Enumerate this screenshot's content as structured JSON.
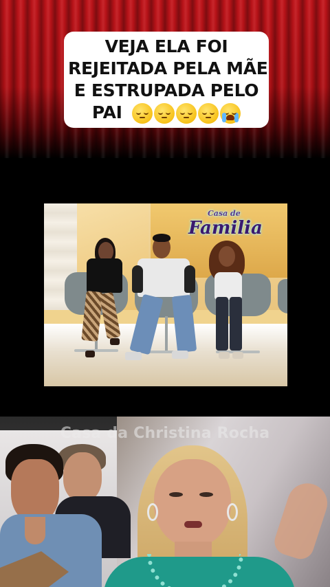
{
  "caption": {
    "line1": "VEJA ELA FOI",
    "line2": "REJEITADA PELA MÃE",
    "line3": "E ESTRUPADA PELO",
    "line4": "PAI",
    "emojis": [
      "pensive-face",
      "pensive-face",
      "pensive-face",
      "pensive-face",
      "loudly-crying-face"
    ]
  },
  "video": {
    "show_logo_small": "Casa",
    "show_logo_small2": "de",
    "show_logo_big": "Familia"
  },
  "bottom": {
    "watermark": "Casa da Christina Rocha"
  },
  "colors": {
    "curtain_red": "#c3141a",
    "dress_teal": "#1f9a8a"
  }
}
